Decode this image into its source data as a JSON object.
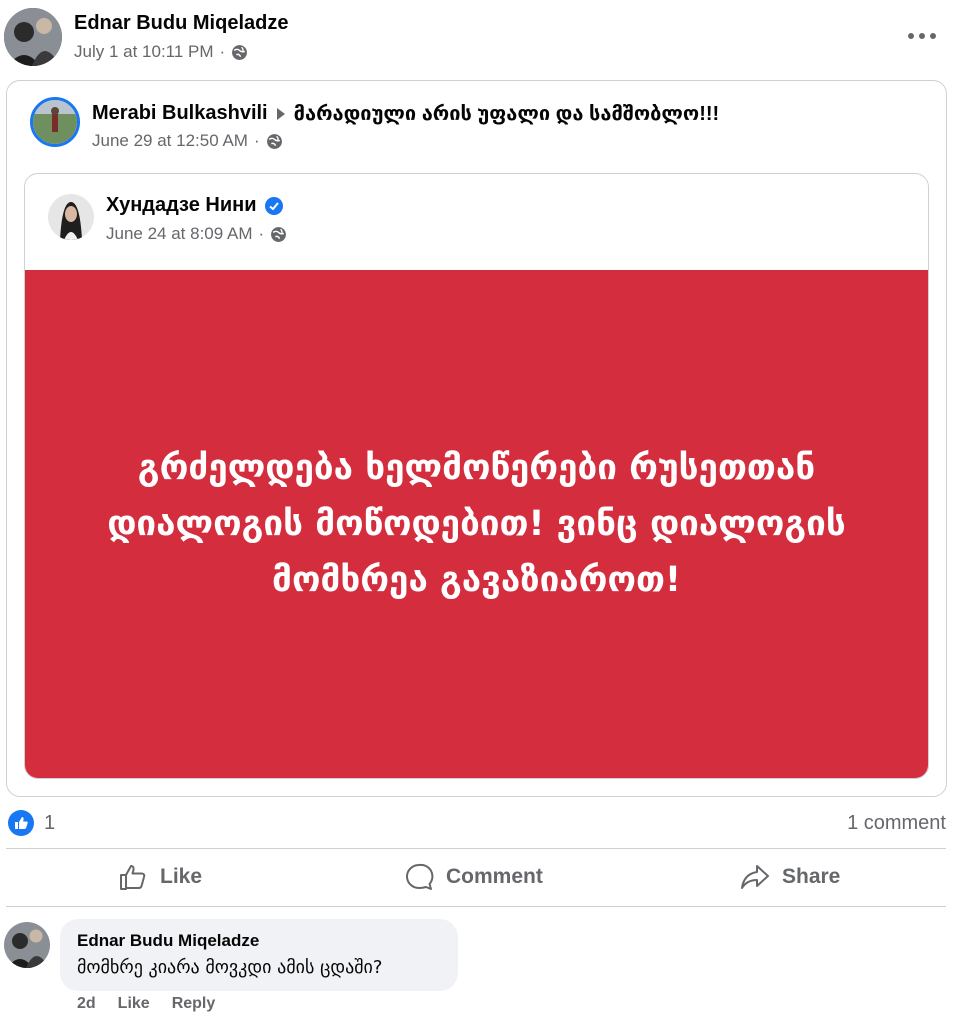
{
  "post": {
    "author": "Ednar Budu Miqeladze",
    "timestamp": "July 1 at 10:11 PM",
    "visibility_icon": "globe-icon",
    "more_icon": "more-options-icon"
  },
  "shared": {
    "author": "Merabi Bulkashvili",
    "target": "მარადიული არის უფალი და სამშობლო!!!",
    "timestamp": "June 29 at 12:50 AM"
  },
  "original": {
    "author": "Хундадзе Нини",
    "verified_icon": "verified-badge-icon",
    "timestamp": "June 24 at 8:09 AM",
    "card_text": "გრძელდება ხელმოწერები რუსეთთან დიალოგის მოწოდებით! ვინც დიალოგის მომხრეა გავაზიაროთ!",
    "card_color": "#d42d3e"
  },
  "stats": {
    "reaction_count": "1",
    "comments": "1 comment",
    "reaction_icon": "like-reaction-icon"
  },
  "actions": {
    "like": "Like",
    "comment": "Comment",
    "share": "Share"
  },
  "comment": {
    "author": "Ednar Budu Miqeladze",
    "text": "მომხრე კიარა მოვკდი ამის ცდაში?",
    "age": "2d",
    "like": "Like",
    "reply": "Reply"
  },
  "colors": {
    "accent": "#1877f2",
    "muted": "#65676b",
    "bubble": "#f0f2f5"
  }
}
